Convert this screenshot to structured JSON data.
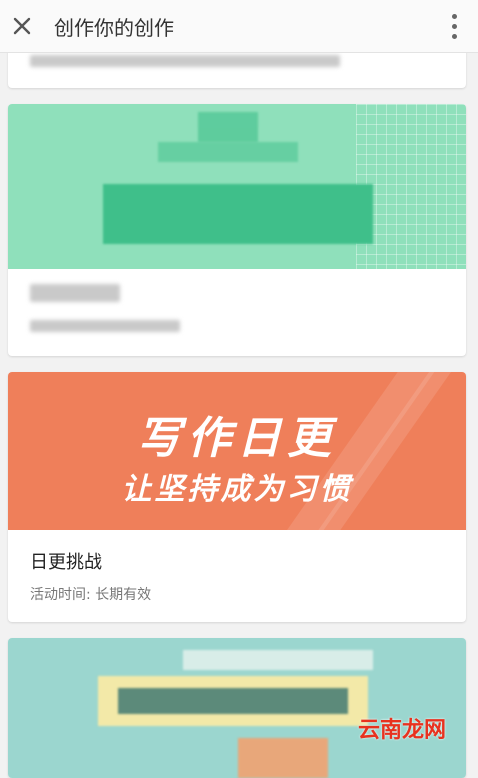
{
  "header": {
    "title": "创作你的创作",
    "close_icon": "close-icon",
    "more_icon": "more-vertical-icon"
  },
  "cards": [
    {
      "meta": "活动..."
    },
    {
      "title": "",
      "meta": "活动..."
    },
    {
      "banner_line1": "写作日更",
      "banner_line2": "让坚持成为习惯",
      "title": "日更挑战",
      "meta": "活动时间: 长期有效"
    },
    {}
  ],
  "watermark": "云南龙网",
  "colors": {
    "green_banner": "#8fe0bb",
    "orange_banner": "#ef7f5a",
    "teal_banner": "#9bd6cf"
  }
}
